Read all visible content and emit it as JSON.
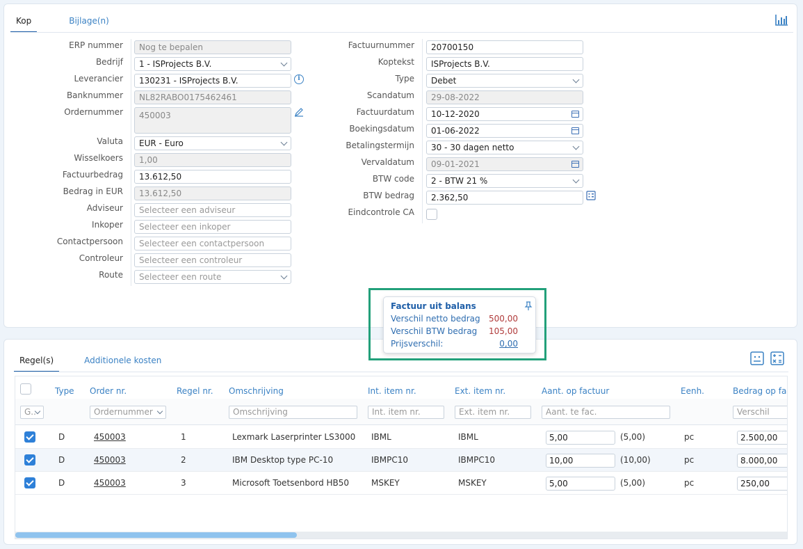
{
  "header": {
    "tabs": [
      {
        "label": "Kop"
      },
      {
        "label": "Bijlage(n)"
      }
    ]
  },
  "form_left": {
    "erp_nummer": {
      "label": "ERP nummer",
      "value": "Nog te bepalen"
    },
    "bedrijf": {
      "label": "Bedrijf",
      "value": "1 - ISProjects B.V."
    },
    "leverancier": {
      "label": "Leverancier",
      "value": "130231 - ISProjects B.V."
    },
    "banknummer": {
      "label": "Banknummer",
      "value": "NL82RABO0175462461"
    },
    "ordernummer": {
      "label": "Ordernummer",
      "value": "450003"
    },
    "valuta": {
      "label": "Valuta",
      "value": "EUR - Euro"
    },
    "wisselkoers": {
      "label": "Wisselkoers",
      "value": "1,00"
    },
    "factuurbedrag": {
      "label": "Factuurbedrag",
      "value": "13.612,50"
    },
    "bedrag_eur": {
      "label": "Bedrag in EUR",
      "value": "13.612,50"
    },
    "adviseur": {
      "label": "Adviseur",
      "placeholder": "Selecteer een adviseur"
    },
    "inkoper": {
      "label": "Inkoper",
      "placeholder": "Selecteer een inkoper"
    },
    "contactpersoon": {
      "label": "Contactpersoon",
      "placeholder": "Selecteer een contactpersoon"
    },
    "controleur": {
      "label": "Controleur",
      "placeholder": "Selecteer een controleur"
    },
    "route": {
      "label": "Route",
      "placeholder": "Selecteer een route"
    }
  },
  "form_right": {
    "factuurnummer": {
      "label": "Factuurnummer",
      "value": "20700150"
    },
    "koptekst": {
      "label": "Koptekst",
      "value": "ISProjects B.V."
    },
    "type": {
      "label": "Type",
      "value": "Debet"
    },
    "scandatum": {
      "label": "Scandatum",
      "value": "29-08-2022"
    },
    "factuurdatum": {
      "label": "Factuurdatum",
      "value": "10-12-2020"
    },
    "boekingsdatum": {
      "label": "Boekingsdatum",
      "value": "01-06-2022"
    },
    "betalingstermijn": {
      "label": "Betalingstermijn",
      "value": "30 - 30 dagen netto"
    },
    "vervaldatum": {
      "label": "Vervaldatum",
      "value": "09-01-2021"
    },
    "btw_code": {
      "label": "BTW code",
      "value": "2 - BTW 21 %"
    },
    "btw_bedrag": {
      "label": "BTW bedrag",
      "value": "2.362,50"
    },
    "eindcontrole": {
      "label": "Eindcontrole CA"
    }
  },
  "balance": {
    "title": "Factuur uit balans",
    "rows": [
      {
        "label": "Verschil netto bedrag",
        "value": "500,00"
      },
      {
        "label": "Verschil BTW bedrag",
        "value": "105,00"
      },
      {
        "label": "Prijsverschil:",
        "value": "0,00"
      }
    ]
  },
  "lines": {
    "tabs": [
      {
        "label": "Regel(s)"
      },
      {
        "label": "Additionele kosten"
      }
    ],
    "columns": [
      "Type",
      "Order nr.",
      "Regel nr.",
      "Omschrijving",
      "Int. item nr.",
      "Ext. item nr.",
      "Aant. op factuur",
      "Eenh.",
      "Bedrag op fac"
    ],
    "filters": {
      "type": "G..",
      "order": "Ordernummer",
      "omschrijving": "Omschrijving",
      "int": "Int. item nr.",
      "ext": "Ext. item nr.",
      "aant": "Aant. te fac.",
      "bedrag": "Verschil"
    },
    "rows": [
      {
        "type": "D",
        "order": "450003",
        "regel": "1",
        "omschrijving": "Lexmark Laserprinter LS3000",
        "int": "IBML",
        "ext": "IBML",
        "aant": "5,00",
        "aant_orig": "(5,00)",
        "eenh": "pc",
        "bedrag": "2.500,00"
      },
      {
        "type": "D",
        "order": "450003",
        "regel": "2",
        "omschrijving": "IBM Desktop type PC-10",
        "int": "IBMPC10",
        "ext": "IBMPC10",
        "aant": "10,00",
        "aant_orig": "(10,00)",
        "eenh": "pc",
        "bedrag": "8.000,00"
      },
      {
        "type": "D",
        "order": "450003",
        "regel": "3",
        "omschrijving": "Microsoft Toetsenbord HB50",
        "int": "MSKEY",
        "ext": "MSKEY",
        "aant": "5,00",
        "aant_orig": "(5,00)",
        "eenh": "pc",
        "bedrag": "250,00"
      }
    ]
  }
}
